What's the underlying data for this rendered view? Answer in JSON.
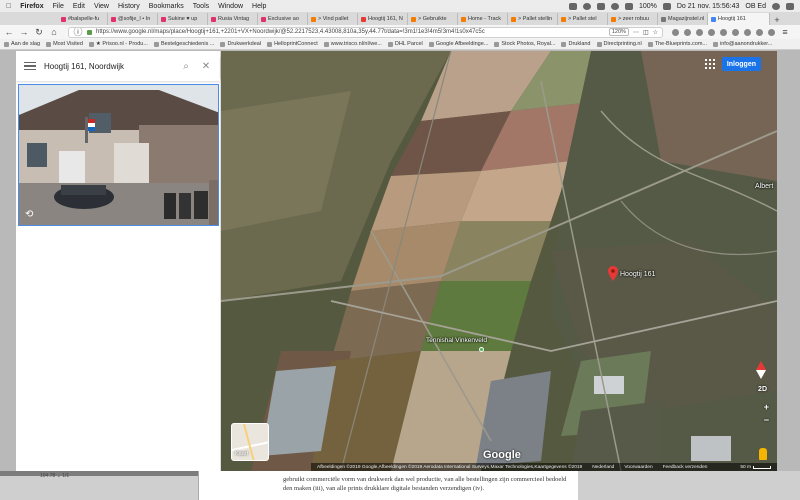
{
  "menubar": {
    "app": "Firefox",
    "items": [
      "File",
      "Edit",
      "View",
      "History",
      "Bookmarks",
      "Tools",
      "Window",
      "Help"
    ],
    "clock": "Do 21 nov. 15:56:43",
    "user": "OB Ed",
    "battery": "100%"
  },
  "tabs": [
    {
      "label": "#balspelle-fu",
      "color": "#e1306c"
    },
    {
      "label": "@sofije_l • In",
      "color": "#e1306c"
    },
    {
      "label": "Sukine ♥ up",
      "color": "#e1306c"
    },
    {
      "label": "Rusia Vintag",
      "color": "#e1306c"
    },
    {
      "label": "Exclusive ao",
      "color": "#e1306c"
    },
    {
      "label": "> Vind pallet",
      "color": "#f57c00"
    },
    {
      "label": "Hoogtij 161, N",
      "color": "#e53935"
    },
    {
      "label": "> Gebruikte",
      "color": "#f57c00"
    },
    {
      "label": "Home - Track",
      "color": "#f57c00"
    },
    {
      "label": "> Pallet stellin",
      "color": "#f57c00"
    },
    {
      "label": "> Pallet stel",
      "color": "#f57c00"
    },
    {
      "label": "> zeer robuu",
      "color": "#f57c00"
    },
    {
      "label": "Magazijnstel.nl",
      "color": "#777"
    },
    {
      "label": "Hoogtij 161",
      "color": "#4285f4",
      "active": true
    }
  ],
  "nav": {
    "url": "https://www.google.nl/maps/place/Hoogtij+161,+2201+VX+Noordwijk/@52.2217523,4.43008,810a,35y,44.77t/data=!3m1!1e3!4m5!3m4!1s0x47c5c",
    "zoom": "120%"
  },
  "bookmarks": [
    "Aan de slag",
    "Most Visited",
    "★ Prisoo.nl - Produ...",
    "Bestelgeschiedenis ...",
    "Drukwerkdeal",
    "HelloprintConnect",
    "www.trisco.nl/nl/we...",
    "DHL Parcel",
    "Google Afbeeldinge...",
    "Stock Photos, Royal...",
    "Drukland",
    "Directprinting.nl",
    "The-Blueprints.com...",
    "info@aanondrukker..."
  ],
  "search": {
    "query": "Hoogtij 161, Noordwijk"
  },
  "map": {
    "signin_label": "Inloggen",
    "place_label": "Hoogtij 161",
    "tennis_label": "Tennishal Vinkenveld",
    "area_label": "Albert",
    "thumbnail_label": "Kaart",
    "logo": "Google",
    "attribution": "Afbeeldingen ©2019 Google,Afbeeldingen ©2019 Aerodata International Surveys,Maxar Technologies,Kaartgegevens ©2019",
    "country": "Nederland",
    "terms": "Voorwaarden",
    "feedback": "Feedback verzenden",
    "scale": "50 m",
    "view_toggle": "2D",
    "zoom_in": "+",
    "zoom_out": "−",
    "colors": {
      "pin": "#e53935",
      "signin": "#1a73e8",
      "tennis": "#4caf50"
    }
  },
  "desktop": {
    "doc_lines": [
      "gebruikt commerciële vorm van drukwerk dan wel productie, van alle bestellingen zijn commercieel bedoeld",
      "den maken (iii), van alle prints drukklare digitale bestanden verzendigen (iv)."
    ],
    "left_text": "104.78  ⌄ 1/1"
  }
}
